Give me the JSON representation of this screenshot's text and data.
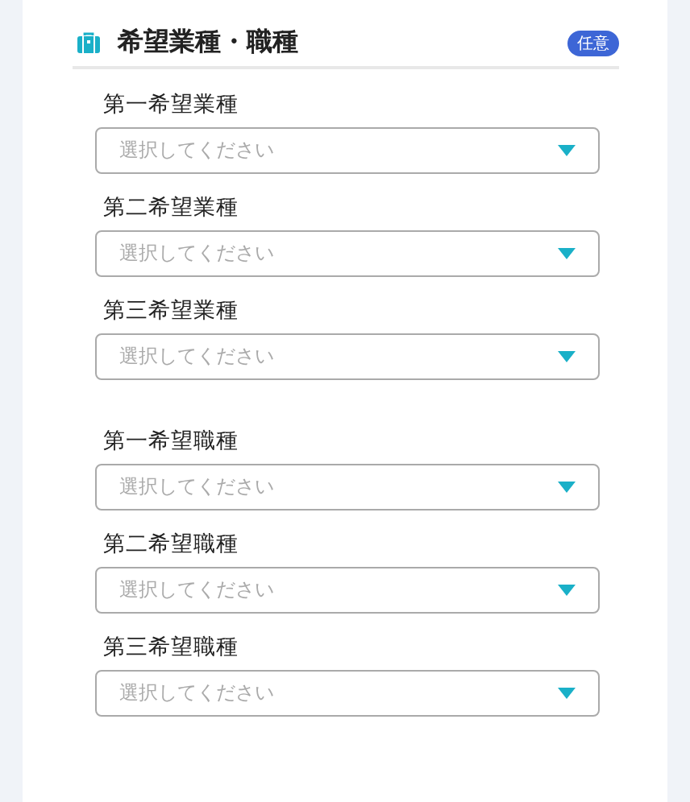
{
  "section": {
    "title": "希望業種・職種",
    "badge": "任意"
  },
  "groups": [
    {
      "fields": [
        {
          "label": "第一希望業種",
          "placeholder": "選択してください"
        },
        {
          "label": "第二希望業種",
          "placeholder": "選択してください"
        },
        {
          "label": "第三希望業種",
          "placeholder": "選択してください"
        }
      ]
    },
    {
      "fields": [
        {
          "label": "第一希望職種",
          "placeholder": "選択してください"
        },
        {
          "label": "第二希望職種",
          "placeholder": "選択してください"
        },
        {
          "label": "第三希望職種",
          "placeholder": "選択してください"
        }
      ]
    }
  ]
}
